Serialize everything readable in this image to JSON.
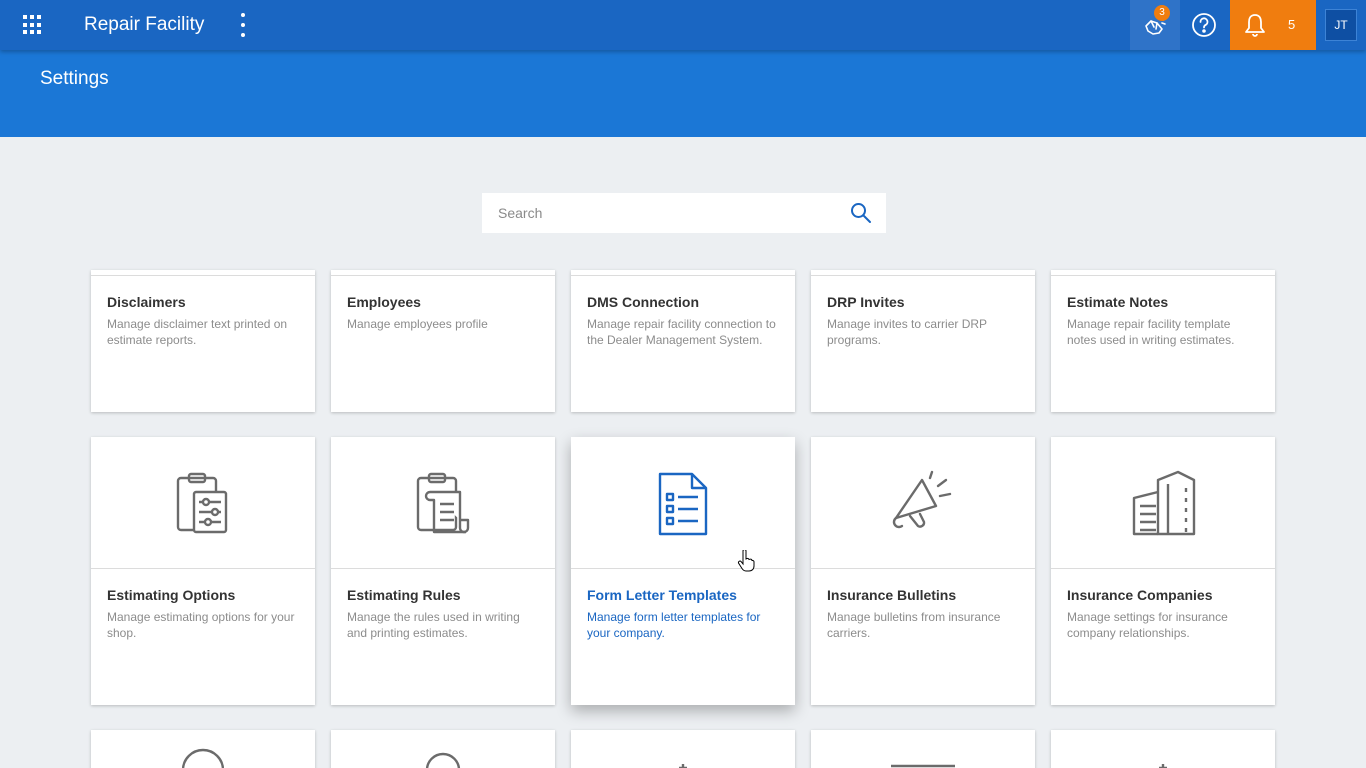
{
  "header": {
    "app_title": "Repair Facility",
    "celebrate_badge": "3",
    "notifications_count": "5",
    "avatar_initials": "JT"
  },
  "page": {
    "title": "Settings"
  },
  "search": {
    "placeholder": "Search"
  },
  "cards_row1": [
    {
      "title": "Disclaimers",
      "desc": "Manage disclaimer text printed on estimate reports."
    },
    {
      "title": "Employees",
      "desc": "Manage employees profile"
    },
    {
      "title": "DMS Connection",
      "desc": "Manage repair facility connection to the Dealer Management System."
    },
    {
      "title": "DRP Invites",
      "desc": "Manage invites to carrier DRP programs."
    },
    {
      "title": "Estimate Notes",
      "desc": "Manage repair facility template notes used in writing estimates."
    }
  ],
  "cards_row2": [
    {
      "title": "Estimating Options",
      "desc": "Manage estimating options for your shop.",
      "icon": "clipboard-sliders-icon"
    },
    {
      "title": "Estimating Rules",
      "desc": "Manage the rules used in writing and printing estimates.",
      "icon": "clipboard-scroll-icon"
    },
    {
      "title": "Form Letter Templates",
      "desc": "Manage form letter templates for your company.",
      "icon": "document-list-icon"
    },
    {
      "title": "Insurance Bulletins",
      "desc": "Manage bulletins from insurance carriers.",
      "icon": "megaphone-icon"
    },
    {
      "title": "Insurance Companies",
      "desc": "Manage settings for insurance company relationships.",
      "icon": "building-icon"
    }
  ],
  "colors": {
    "topbar": "#1a66c2",
    "banner": "#1b77d6",
    "accent_orange": "#f07d0f",
    "active_text": "#1a66c2"
  }
}
